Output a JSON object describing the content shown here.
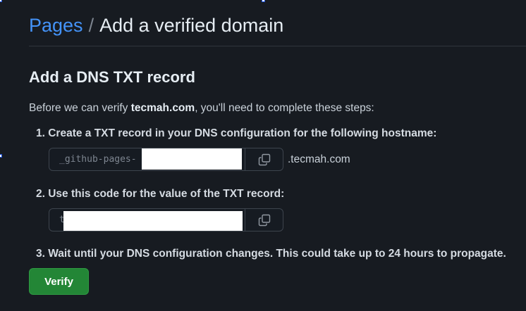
{
  "breadcrumb": {
    "parent": "Pages",
    "separator": "/",
    "current": "Add a verified domain"
  },
  "section": {
    "title": "Add a DNS TXT record",
    "intro_prefix": "Before we can verify ",
    "domain": "tecmah.com",
    "intro_suffix": ", you'll need to complete these steps:"
  },
  "steps": [
    {
      "label": "1. Create a TXT record in your DNS configuration for the following hostname:"
    },
    {
      "label": "2. Use this code for the value of the TXT record:"
    },
    {
      "label": "3. Wait until your DNS configuration changes. This could take up to 24 hours to propagate."
    }
  ],
  "hostname_field": {
    "value": "_github-pages-",
    "suffix": ".tecmah.com",
    "copy_icon": "copy-icon"
  },
  "code_field": {
    "value": "t",
    "copy_icon": "copy-icon"
  },
  "verify_button": {
    "label": "Verify"
  },
  "colors": {
    "background": "#171b21",
    "link": "#4493f8",
    "primary_button": "#238636",
    "border": "#3d444d"
  }
}
